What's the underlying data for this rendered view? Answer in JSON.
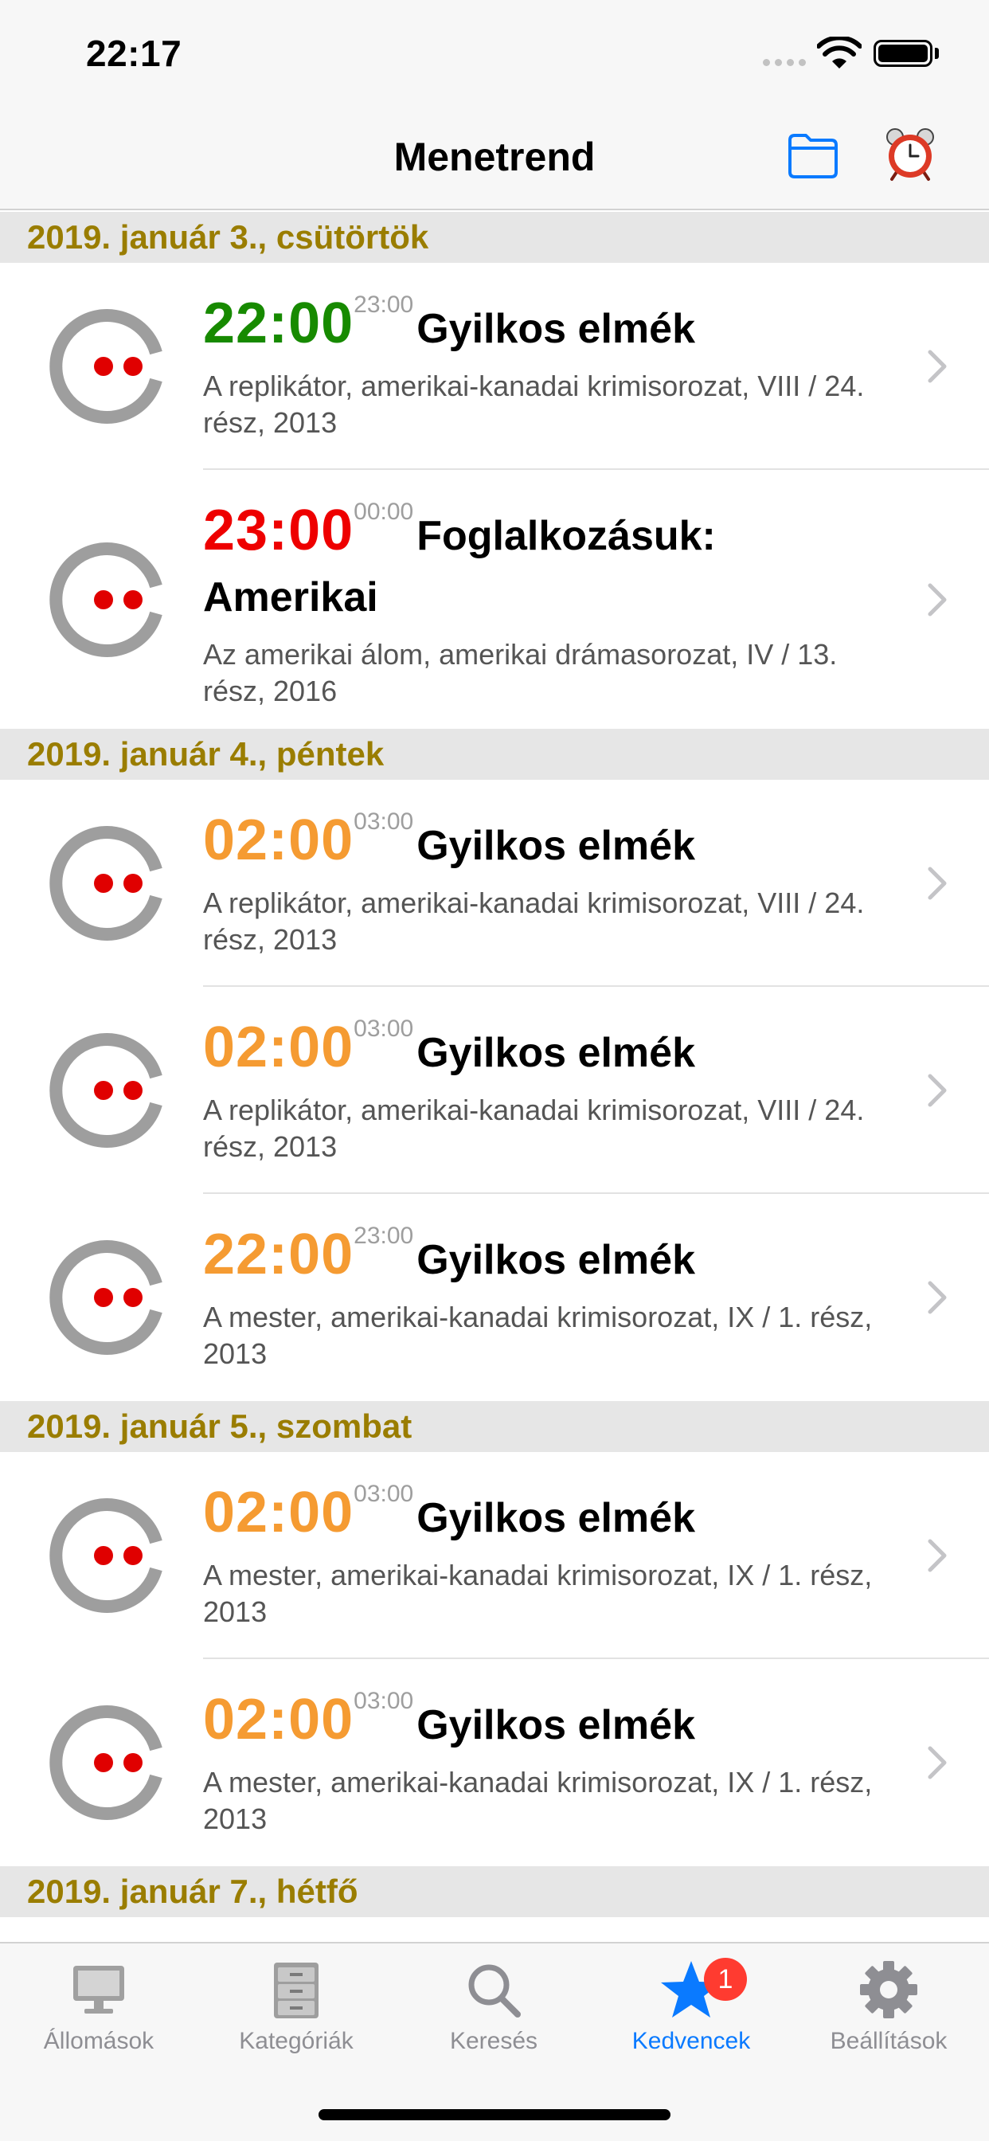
{
  "status_bar": {
    "time": "22:17"
  },
  "nav": {
    "title": "Menetrend",
    "folder_icon": "folder-icon",
    "alarm_icon": "alarm-clock-icon"
  },
  "colors": {
    "section_header_text": "#9a7d00",
    "live_green": "#178a00",
    "upcoming_red": "#ee0000",
    "later_orange": "#f59b32",
    "tint": "#0a7aff"
  },
  "sections": [
    {
      "header": "2019. január 3., csütörtök",
      "rows": [
        {
          "start": "22:00",
          "end": "23:00",
          "title": "Gyilkos elmék",
          "desc": "A replikátor, amerikai-kanadai krimisorozat, VIII / 24. rész, 2013",
          "time_color": "green"
        },
        {
          "start": "23:00",
          "end": "00:00",
          "title": "Foglalkozásuk: Amerikai",
          "desc": "Az amerikai álom, amerikai drámasorozat, IV / 13. rész, 2016",
          "time_color": "red"
        }
      ]
    },
    {
      "header": "2019. január 4., péntek",
      "rows": [
        {
          "start": "02:00",
          "end": "03:00",
          "title": "Gyilkos elmék",
          "desc": "A replikátor, amerikai-kanadai krimisorozat, VIII / 24. rész, 2013",
          "time_color": "orange"
        },
        {
          "start": "02:00",
          "end": "03:00",
          "title": "Gyilkos elmék",
          "desc": "A replikátor, amerikai-kanadai krimisorozat, VIII / 24. rész, 2013",
          "time_color": "orange"
        },
        {
          "start": "22:00",
          "end": "23:00",
          "title": "Gyilkos elmék",
          "desc": "A mester, amerikai-kanadai krimisorozat, IX / 1. rész, 2013",
          "time_color": "orange"
        }
      ]
    },
    {
      "header": "2019. január 5., szombat",
      "rows": [
        {
          "start": "02:00",
          "end": "03:00",
          "title": "Gyilkos elmék",
          "desc": "A mester, amerikai-kanadai krimisorozat, IX / 1. rész, 2013",
          "time_color": "orange"
        },
        {
          "start": "02:00",
          "end": "03:00",
          "title": "Gyilkos elmék",
          "desc": "A mester, amerikai-kanadai krimisorozat, IX / 1. rész, 2013",
          "time_color": "orange"
        }
      ]
    },
    {
      "header": "2019. január 7., hétfő",
      "rows": []
    }
  ],
  "tabs": [
    {
      "label": "Állomások",
      "icon": "monitor-icon",
      "active": false
    },
    {
      "label": "Kategóriák",
      "icon": "cabinet-icon",
      "active": false
    },
    {
      "label": "Keresés",
      "icon": "search-icon",
      "active": false
    },
    {
      "label": "Kedvencek",
      "icon": "star-icon",
      "active": true,
      "badge": "1"
    },
    {
      "label": "Beállítások",
      "icon": "gear-icon",
      "active": false
    }
  ]
}
